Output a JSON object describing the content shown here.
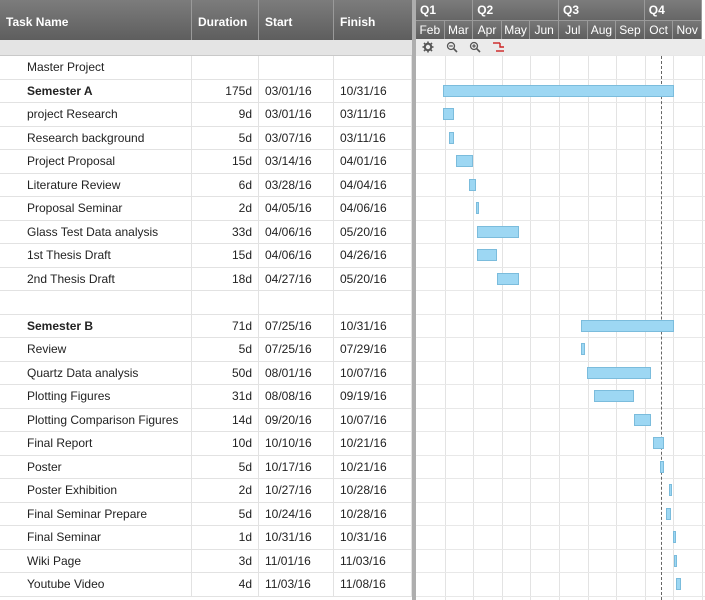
{
  "columns": {
    "name": "Task Name",
    "duration": "Duration",
    "start": "Start",
    "finish": "Finish"
  },
  "quarters": [
    "Q1",
    "Q2",
    "Q3",
    "Q4"
  ],
  "months": [
    "Feb",
    "Mar",
    "Apr",
    "May",
    "Jun",
    "Jul",
    "Aug",
    "Sep",
    "Oct",
    "Nov"
  ],
  "tasks": [
    {
      "name": "Master Project",
      "duration": "",
      "start": "",
      "finish": "",
      "bold": false
    },
    {
      "name": "Semester A",
      "duration": "175d",
      "start": "03/01/16",
      "finish": "10/31/16",
      "bold": true
    },
    {
      "name": "project Research",
      "duration": "9d",
      "start": "03/01/16",
      "finish": "03/11/16",
      "bold": false
    },
    {
      "name": "Research background",
      "duration": "5d",
      "start": "03/07/16",
      "finish": "03/11/16",
      "bold": false
    },
    {
      "name": "Project Proposal",
      "duration": "15d",
      "start": "03/14/16",
      "finish": "04/01/16",
      "bold": false
    },
    {
      "name": "Literature Review",
      "duration": "6d",
      "start": "03/28/16",
      "finish": "04/04/16",
      "bold": false
    },
    {
      "name": "Proposal Seminar",
      "duration": "2d",
      "start": "04/05/16",
      "finish": "04/06/16",
      "bold": false
    },
    {
      "name": "Glass Test Data analysis",
      "duration": "33d",
      "start": "04/06/16",
      "finish": "05/20/16",
      "bold": false
    },
    {
      "name": "1st Thesis Draft",
      "duration": "15d",
      "start": "04/06/16",
      "finish": "04/26/16",
      "bold": false
    },
    {
      "name": "2nd Thesis Draft",
      "duration": "18d",
      "start": "04/27/16",
      "finish": "05/20/16",
      "bold": false
    },
    {
      "name": "",
      "duration": "",
      "start": "",
      "finish": "",
      "bold": false
    },
    {
      "name": "Semester B",
      "duration": "71d",
      "start": "07/25/16",
      "finish": "10/31/16",
      "bold": true
    },
    {
      "name": "Review",
      "duration": "5d",
      "start": "07/25/16",
      "finish": "07/29/16",
      "bold": false
    },
    {
      "name": "Quartz Data analysis",
      "duration": "50d",
      "start": "08/01/16",
      "finish": "10/07/16",
      "bold": false
    },
    {
      "name": "Plotting Figures",
      "duration": "31d",
      "start": "08/08/16",
      "finish": "09/19/16",
      "bold": false
    },
    {
      "name": "Plotting Comparison Figures",
      "duration": "14d",
      "start": "09/20/16",
      "finish": "10/07/16",
      "bold": false
    },
    {
      "name": "Final Report",
      "duration": "10d",
      "start": "10/10/16",
      "finish": "10/21/16",
      "bold": false
    },
    {
      "name": "Poster",
      "duration": "5d",
      "start": "10/17/16",
      "finish": "10/21/16",
      "bold": false
    },
    {
      "name": "Poster Exhibition",
      "duration": "2d",
      "start": "10/27/16",
      "finish": "10/28/16",
      "bold": false
    },
    {
      "name": "Final Seminar Prepare",
      "duration": "5d",
      "start": "10/24/16",
      "finish": "10/28/16",
      "bold": false
    },
    {
      "name": "Final Seminar",
      "duration": "1d",
      "start": "10/31/16",
      "finish": "10/31/16",
      "bold": false
    },
    {
      "name": "Wiki Page",
      "duration": "3d",
      "start": "11/01/16",
      "finish": "11/03/16",
      "bold": false
    },
    {
      "name": "Youtube Video",
      "duration": "4d",
      "start": "11/03/16",
      "finish": "11/08/16",
      "bold": false
    }
  ],
  "toolbar": {
    "settings_icon": "gear-icon",
    "zoom_out_icon": "zoom-out-icon",
    "zoom_in_icon": "zoom-in-icon",
    "critical_path_icon": "critical-path-icon"
  },
  "colors": {
    "bar": "#9dd7f3",
    "bar_border": "#7bbcdc",
    "header": "#6b6b6b",
    "critical_icon": "#cc2222"
  }
}
